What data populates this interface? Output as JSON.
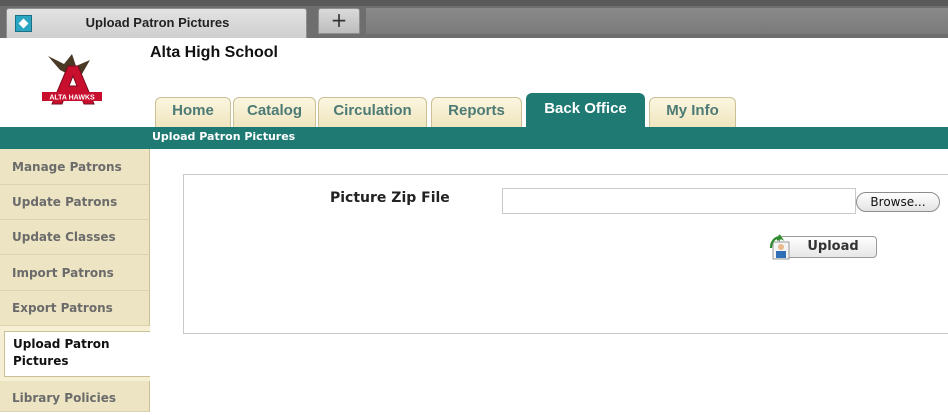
{
  "browser": {
    "tab_title": "Upload Patron Pictures",
    "new_tab_label": "+"
  },
  "header": {
    "school_name": "Alta High School",
    "logo_text": "ALTA HAWKS"
  },
  "nav": {
    "tabs": [
      {
        "label": "Home",
        "active": false
      },
      {
        "label": "Catalog",
        "active": false
      },
      {
        "label": "Circulation",
        "active": false
      },
      {
        "label": "Reports",
        "active": false
      },
      {
        "label": "Back Office",
        "active": true
      },
      {
        "label": "My Info",
        "active": false
      }
    ]
  },
  "subbar": {
    "title": "Upload Patron Pictures"
  },
  "sidebar": {
    "items": [
      {
        "label": "Manage Patrons"
      },
      {
        "label": "Update Patrons"
      },
      {
        "label": "Update Classes"
      },
      {
        "label": "Import Patrons"
      },
      {
        "label": "Export Patrons"
      },
      {
        "label": "Upload Patron Pictures",
        "active": true
      },
      {
        "label": "Library Policies"
      }
    ]
  },
  "form": {
    "field_label": "Picture Zip File",
    "file_value": "",
    "browse_label": "Browse...",
    "upload_label": "Upload"
  },
  "colors": {
    "accent_teal": "#1f7a74",
    "tab_beige": "#efe5be",
    "logo_red": "#c8102e"
  }
}
